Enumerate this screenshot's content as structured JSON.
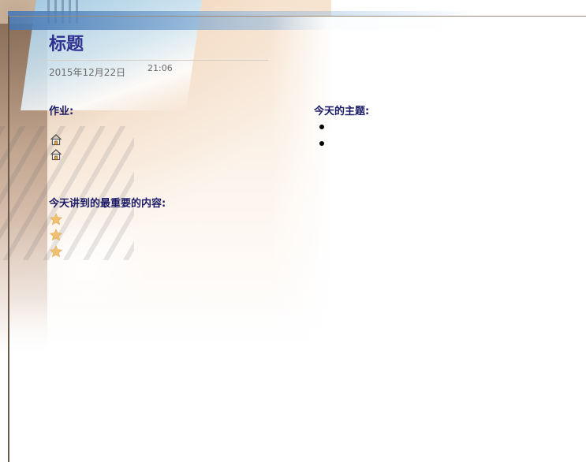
{
  "page": {
    "title": "标题",
    "date": "2015年12月22日",
    "time": "21:06"
  },
  "homework": {
    "heading": "作业:",
    "items": [
      {
        "icon": "house-icon",
        "text": ""
      },
      {
        "icon": "house-icon",
        "text": ""
      }
    ]
  },
  "topics": {
    "heading": "今天的主题:",
    "items": [
      {
        "text": ""
      },
      {
        "text": ""
      }
    ]
  },
  "key_points": {
    "heading": "今天讲到的最重要的内容:",
    "items": [
      {
        "icon": "star-icon",
        "text": ""
      },
      {
        "icon": "star-icon",
        "text": ""
      },
      {
        "icon": "star-icon",
        "text": ""
      }
    ]
  },
  "colors": {
    "title": "#2e2f8f",
    "heading": "#1a1a66",
    "star": "#f0c070",
    "meta_text": "#6a6a6a"
  }
}
